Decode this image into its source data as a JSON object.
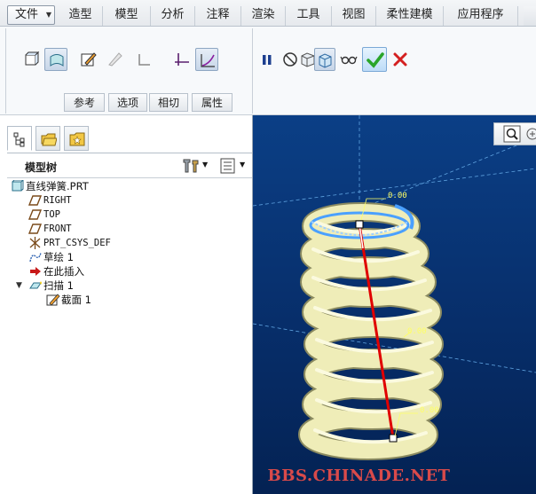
{
  "menu": {
    "file": "文件",
    "tabs": [
      "造型",
      "模型",
      "分析",
      "注释",
      "渲染",
      "工具",
      "视图",
      "柔性建模",
      "应用程序"
    ]
  },
  "ribbon": {
    "subtabs": [
      "参考",
      "选项",
      "相切",
      "属性"
    ],
    "buttons": [
      "solid",
      "surface",
      "edit-section",
      "remove-material",
      "thin",
      "constant-section",
      "variable-section",
      "pause",
      "no-preview",
      "attached-preview",
      "verify",
      "ok",
      "cancel"
    ]
  },
  "panel": {
    "tabs": [
      "model-tree",
      "folder-browser",
      "favorites"
    ],
    "tree_title": "模型树",
    "items": [
      {
        "label": "直线弹簧.PRT",
        "icon": "part-icon"
      },
      {
        "label": "RIGHT",
        "icon": "datum-plane-icon"
      },
      {
        "label": "TOP",
        "icon": "datum-plane-icon"
      },
      {
        "label": "FRONT",
        "icon": "datum-plane-icon"
      },
      {
        "label": "PRT_CSYS_DEF",
        "icon": "csys-icon"
      },
      {
        "label": "草绘 1",
        "icon": "sketch-icon"
      },
      {
        "label": "在此插入",
        "icon": "insert-arrow-icon"
      },
      {
        "label": "扫描 1",
        "icon": "sweep-icon"
      },
      {
        "label": "截面 1",
        "icon": "section-icon"
      }
    ]
  },
  "viewport": {
    "dims": [
      "0.00",
      "0.00",
      "0.00"
    ],
    "watermark": "BBS.CHINADE.NET"
  },
  "colors": {
    "viewport_top": "#0b3f86",
    "viewport_bottom": "#042253",
    "spring": "#efedb8",
    "trajectory": "#e00000",
    "ok_green": "#2aa52a",
    "cancel_red": "#d42020",
    "watermark": "#d94a4a"
  }
}
